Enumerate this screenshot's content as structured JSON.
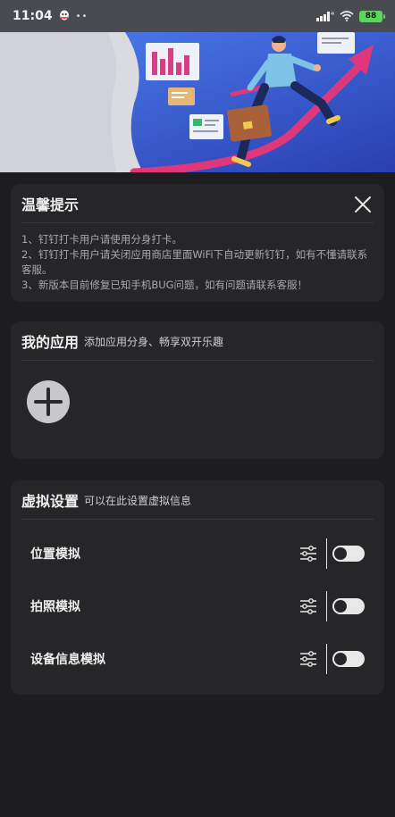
{
  "status_bar": {
    "time": "11:04",
    "notification_dots": "••",
    "battery": "88"
  },
  "tips": {
    "title": "温馨提示",
    "lines": [
      "1、钉钉打卡用户请使用分身打卡。",
      "2、钉钉打卡用户请关闭应用商店里面WiFi下自动更新钉钉，如有不懂请联系客服。",
      "3、新版本目前修复已知手机BUG问题，如有问题请联系客服！"
    ]
  },
  "my_apps": {
    "title": "我的应用",
    "subtitle": "添加应用分身、畅享双开乐趣"
  },
  "virtual_settings": {
    "title": "虚拟设置",
    "subtitle": "可以在此设置虚拟信息",
    "rows": [
      {
        "label": "位置模拟",
        "enabled": false
      },
      {
        "label": "拍照模拟",
        "enabled": false
      },
      {
        "label": "设备信息模拟",
        "enabled": false
      }
    ]
  },
  "colors": {
    "background": "#1d1d1f",
    "card": "#262628",
    "banner": "#3a5fd0",
    "accent_pink": "#e0377a"
  }
}
